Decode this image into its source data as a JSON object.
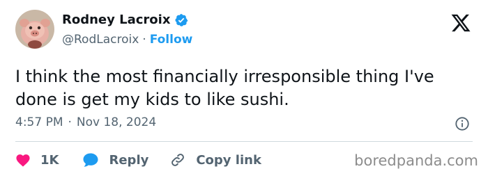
{
  "author": {
    "name": "Rodney Lacroix",
    "handle": "@RodLacroix",
    "separator": "·",
    "follow_label": "Follow",
    "verified_icon": "verified-badge-icon",
    "avatar_icon": "pig-toy-avatar"
  },
  "platform_icon": "x-logo-icon",
  "tweet": {
    "text": "I think the most financially irresponsible thing I've done is get my kids to like sushi.",
    "time": "4:57 PM",
    "separator": "·",
    "date": "Nov 18, 2024"
  },
  "actions": {
    "like_count": "1K",
    "reply_label": "Reply",
    "copy_link_label": "Copy link"
  },
  "watermark": "boredpanda.com",
  "colors": {
    "text": "#0f1419",
    "muted": "#536471",
    "accent": "#1d9bf0",
    "like": "#f91880",
    "divider": "#cfd9de"
  }
}
